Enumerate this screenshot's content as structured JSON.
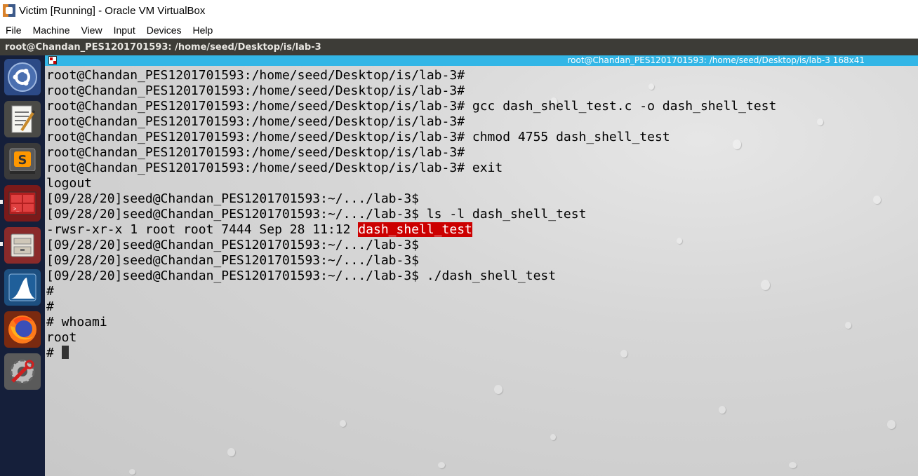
{
  "host": {
    "title": "Victim [Running] - Oracle VM VirtualBox",
    "menu": [
      "File",
      "Machine",
      "View",
      "Input",
      "Devices",
      "Help"
    ]
  },
  "guest_panel": {
    "title": "root@Chandan_PES1201701593: /home/seed/Desktop/is/lab-3"
  },
  "launcher": {
    "items": [
      {
        "icon": "ubuntu-dash-icon"
      },
      {
        "icon": "text-editor-icon"
      },
      {
        "icon": "sublime-text-icon"
      },
      {
        "icon": "terminal-icon"
      },
      {
        "icon": "file-manager-icon"
      },
      {
        "icon": "wireshark-icon"
      },
      {
        "icon": "firefox-icon"
      },
      {
        "icon": "system-settings-icon"
      }
    ]
  },
  "terminal": {
    "title": "root@Chandan_PES1201701593: /home/seed/Desktop/is/lab-3 168x41",
    "lines": [
      "root@Chandan_PES1201701593:/home/seed/Desktop/is/lab-3#",
      "root@Chandan_PES1201701593:/home/seed/Desktop/is/lab-3#",
      "root@Chandan_PES1201701593:/home/seed/Desktop/is/lab-3# gcc dash_shell_test.c -o dash_shell_test",
      "root@Chandan_PES1201701593:/home/seed/Desktop/is/lab-3#",
      "root@Chandan_PES1201701593:/home/seed/Desktop/is/lab-3# chmod 4755 dash_shell_test",
      "root@Chandan_PES1201701593:/home/seed/Desktop/is/lab-3#",
      "root@Chandan_PES1201701593:/home/seed/Desktop/is/lab-3# exit",
      "logout",
      "[09/28/20]seed@Chandan_PES1201701593:~/.../lab-3$",
      "[09/28/20]seed@Chandan_PES1201701593:~/.../lab-3$ ls -l dash_shell_test",
      "-rwsr-xr-x 1 root root 7444 Sep 28 11:12 ",
      "[09/28/20]seed@Chandan_PES1201701593:~/.../lab-3$",
      "[09/28/20]seed@Chandan_PES1201701593:~/.../lab-3$",
      "[09/28/20]seed@Chandan_PES1201701593:~/.../lab-3$ ./dash_shell_test",
      "#",
      "#",
      "# whoami",
      "root",
      "# "
    ],
    "highlighted_filename": "dash_shell_test",
    "highlight_color": "#cc0000"
  }
}
